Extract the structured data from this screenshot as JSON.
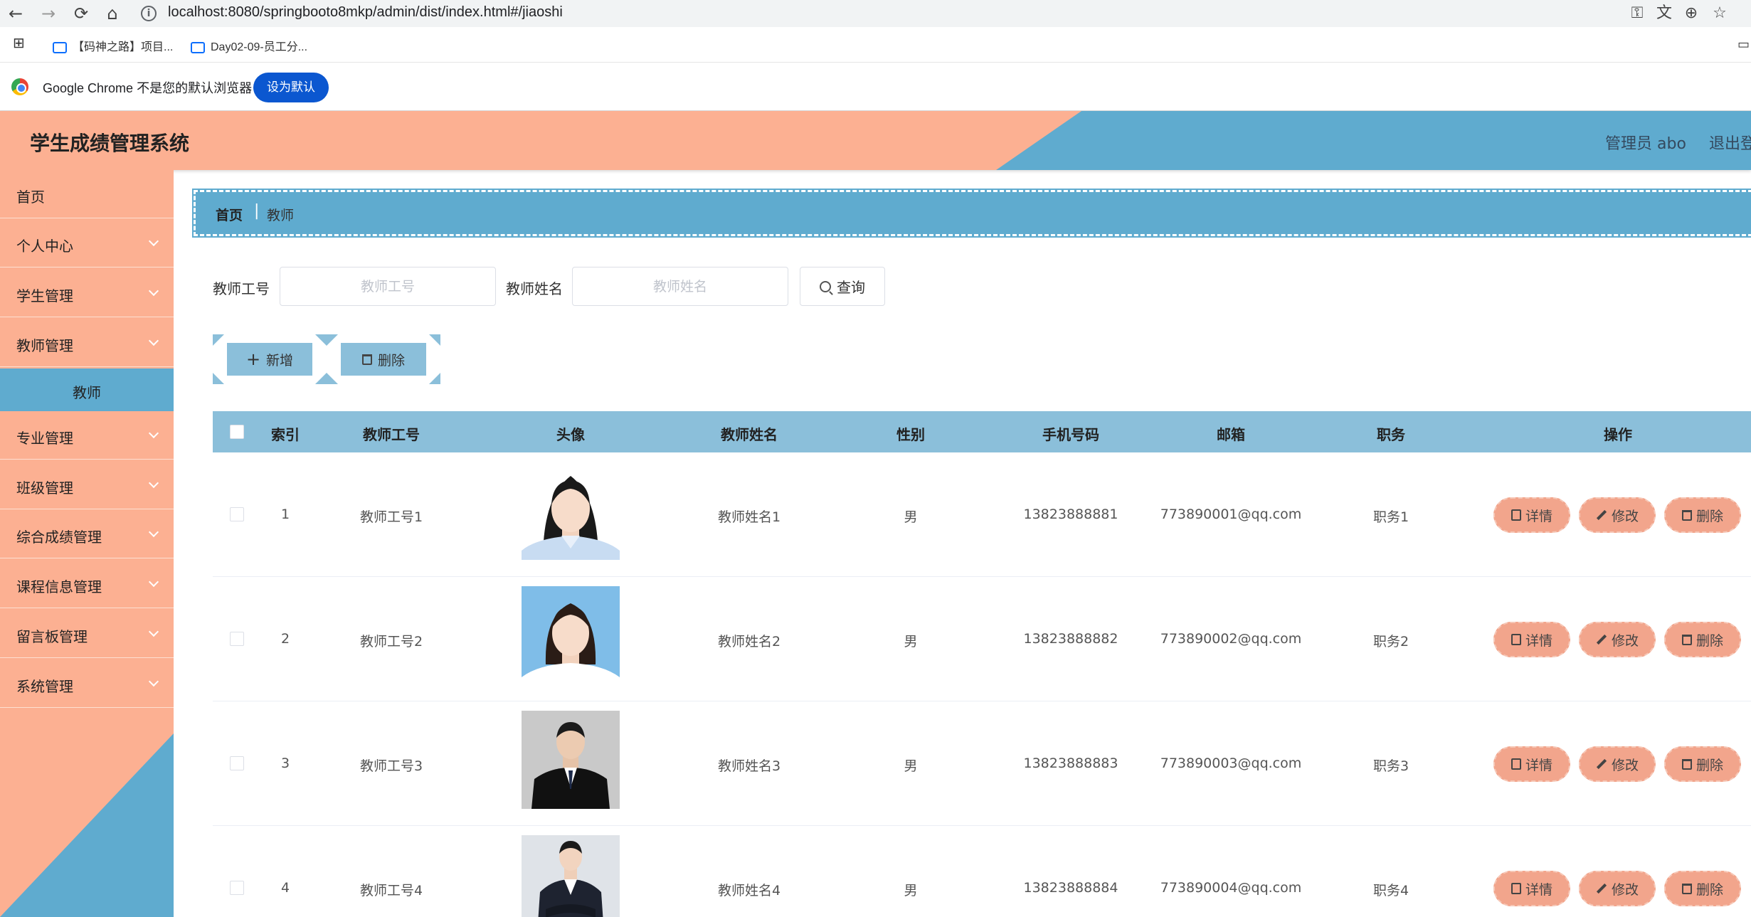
{
  "browser": {
    "url": "localhost:8080/springbooto8mkp/admin/dist/index.html#/jiaoshi",
    "bookmarks": [
      "【码神之路】项目...",
      "Day02-09-员工分..."
    ],
    "default_prompt": "Google Chrome 不是您的默认浏览器",
    "set_default_label": "设为默认"
  },
  "header": {
    "title": "学生成绩管理系统",
    "user": "管理员 abo",
    "logout": "退出登录"
  },
  "sidebar": {
    "items": [
      "首页",
      "个人中心",
      "学生管理",
      "教师管理",
      "专业管理",
      "班级管理",
      "综合成绩管理",
      "课程信息管理",
      "留言板管理",
      "系统管理"
    ],
    "active_sub": "教师"
  },
  "breadcrumb": {
    "home": "首页",
    "sep": "|",
    "current": "教师"
  },
  "search": {
    "id_label": "教师工号",
    "id_placeholder": "教师工号",
    "name_label": "教师姓名",
    "name_placeholder": "教师姓名",
    "query_label": "查询"
  },
  "actions": {
    "add_label": "新增",
    "delete_label": "删除"
  },
  "table": {
    "columns": [
      "索引",
      "教师工号",
      "头像",
      "教师姓名",
      "性别",
      "手机号码",
      "邮箱",
      "职务",
      "操作"
    ],
    "rows": [
      {
        "index": "1",
        "id": "教师工号1",
        "name": "教师姓名1",
        "gender": "男",
        "phone": "13823888881",
        "email": "773890001@qq.com",
        "title": "职务1"
      },
      {
        "index": "2",
        "id": "教师工号2",
        "name": "教师姓名2",
        "gender": "男",
        "phone": "13823888882",
        "email": "773890002@qq.com",
        "title": "职务2"
      },
      {
        "index": "3",
        "id": "教师工号3",
        "name": "教师姓名3",
        "gender": "男",
        "phone": "13823888883",
        "email": "773890003@qq.com",
        "title": "职务3"
      },
      {
        "index": "4",
        "id": "教师工号4",
        "name": "教师姓名4",
        "gender": "男",
        "phone": "13823888884",
        "email": "773890004@qq.com",
        "title": "职务4"
      }
    ],
    "row_actions": {
      "detail": "详情",
      "edit": "修改",
      "delete": "删除"
    }
  },
  "colors": {
    "salmon": "#fcb092",
    "blue": "#5fabcf",
    "light_blue": "#8bbfda",
    "button_salmon": "#f2a58c"
  }
}
